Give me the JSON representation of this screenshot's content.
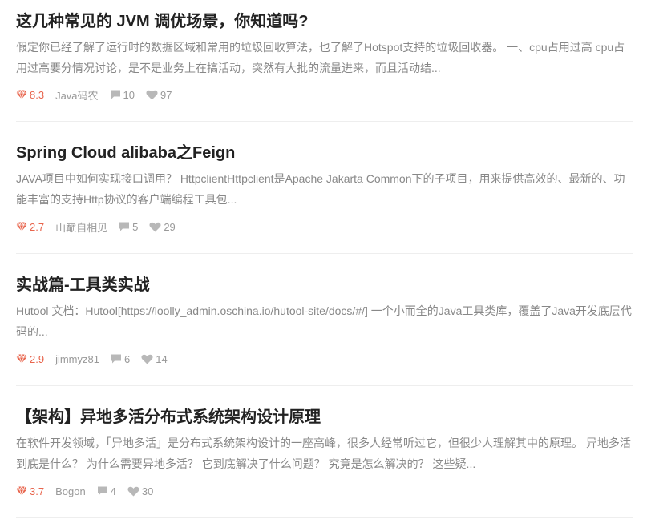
{
  "articles": [
    {
      "title": "这几种常见的 JVM 调优场景，你知道吗?",
      "summary": "假定你已经了解了运行时的数据区域和常用的垃圾回收算法，也了解了Hotspot支持的垃圾回收器。 一、cpu占用过高 cpu占用过高要分情况讨论，是不是业务上在搞活动，突然有大批的流量进来，而且活动结...",
      "score": "8.3",
      "author": "Java码农",
      "comments": "10",
      "likes": "97"
    },
    {
      "title": "Spring Cloud alibaba之Feign",
      "summary": "JAVA项目中如何实现接口调用？ HttpclientHttpclient是Apache Jakarta Common下的子项目，用来提供高效的、最新的、功能丰富的支持Http协议的客户端编程工具包...",
      "score": "2.7",
      "author": "山巅自相见",
      "comments": "5",
      "likes": "29"
    },
    {
      "title": "实战篇-工具类实战",
      "summary": "Hutool 文档：Hutool[https://loolly_admin.oschina.io/hutool-site/docs/#/] 一个小而全的Java工具类库，覆盖了Java开发底层代码的...",
      "score": "2.9",
      "author": "jimmyz81",
      "comments": "6",
      "likes": "14"
    },
    {
      "title": "【架构】异地多活分布式系统架构设计原理",
      "summary": "在软件开发领域，「异地多活」是分布式系统架构设计的一座高峰，很多人经常听过它，但很少人理解其中的原理。 异地多活到底是什么？ 为什么需要异地多活？ 它到底解决了什么问题？ 究竟是怎么解决的？ 这些疑...",
      "score": "3.7",
      "author": "Bogon",
      "comments": "4",
      "likes": "30"
    }
  ],
  "icons": {
    "score": "gem-icon",
    "comments": "comment-icon",
    "likes": "heart-icon"
  },
  "colors": {
    "score": "#e8654d",
    "meta": "#999999",
    "title": "#222222",
    "summary": "#888888"
  }
}
